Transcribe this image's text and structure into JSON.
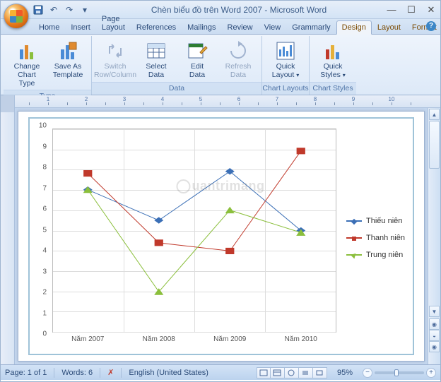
{
  "window": {
    "title": "Chèn biểu đồ trên Word 2007 - Microsoft Word"
  },
  "qat": {
    "save_tip": "Save",
    "undo_tip": "Undo",
    "redo_tip": "Redo"
  },
  "tabs": {
    "items": [
      "Home",
      "Insert",
      "Page Layout",
      "References",
      "Mailings",
      "Review",
      "View",
      "Grammarly",
      "Design",
      "Layout",
      "Format"
    ],
    "active": "Design"
  },
  "ribbon": {
    "groups": [
      {
        "title": "Type",
        "buttons": [
          {
            "name": "change-chart-type",
            "label": "Change Chart Type",
            "enabled": true
          },
          {
            "name": "save-as-template",
            "label": "Save As Template",
            "enabled": true
          }
        ]
      },
      {
        "title": "Data",
        "buttons": [
          {
            "name": "switch-row-column",
            "label": "Switch Row/Column",
            "enabled": false
          },
          {
            "name": "select-data",
            "label": "Select Data",
            "enabled": true
          },
          {
            "name": "edit-data",
            "label": "Edit Data",
            "enabled": true
          },
          {
            "name": "refresh-data",
            "label": "Refresh Data",
            "enabled": false
          }
        ]
      },
      {
        "title": "Chart Layouts",
        "buttons": [
          {
            "name": "quick-layout",
            "label": "Quick Layout",
            "enabled": true,
            "dropdown": true
          }
        ]
      },
      {
        "title": "Chart Styles",
        "buttons": [
          {
            "name": "quick-styles",
            "label": "Quick Styles",
            "enabled": true,
            "dropdown": true
          }
        ]
      }
    ]
  },
  "status": {
    "page": "Page: 1 of 1",
    "words": "Words: 6",
    "language": "English (United States)",
    "zoom": "95%"
  },
  "watermark": "uantrimang",
  "chart_data": {
    "type": "line",
    "categories": [
      "Năm 2007",
      "Năm 2008",
      "Năm 2009",
      "Năm 2010"
    ],
    "series": [
      {
        "name": "Thiếu niên",
        "color": "#3b6fb6",
        "marker": "diamond",
        "values": [
          7.0,
          5.5,
          7.9,
          5.0
        ]
      },
      {
        "name": "Thanh niên",
        "color": "#c0392b",
        "marker": "square",
        "values": [
          7.8,
          4.4,
          4.0,
          8.9
        ]
      },
      {
        "name": "Trung niên",
        "color": "#8bbf3c",
        "marker": "triangle",
        "values": [
          7.0,
          2.0,
          6.0,
          4.9
        ]
      }
    ],
    "ylim": [
      0,
      10
    ],
    "yticks": [
      0,
      1,
      2,
      3,
      4,
      5,
      6,
      7,
      8,
      9,
      10
    ],
    "title": "",
    "xlabel": "",
    "ylabel": ""
  }
}
